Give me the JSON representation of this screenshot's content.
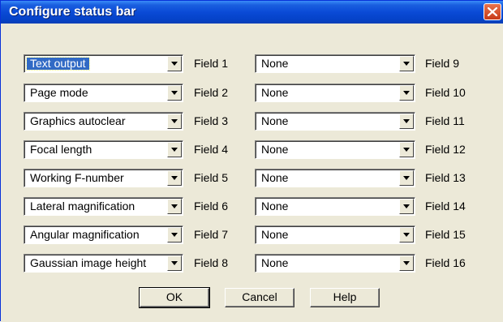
{
  "window": {
    "title": "Configure status bar"
  },
  "fields": [
    {
      "label": "Field 1",
      "value": "Text output",
      "selected": true
    },
    {
      "label": "Field 2",
      "value": "Page mode"
    },
    {
      "label": "Field 3",
      "value": "Graphics autoclear"
    },
    {
      "label": "Field 4",
      "value": "Focal length"
    },
    {
      "label": "Field 5",
      "value": "Working F-number"
    },
    {
      "label": "Field 6",
      "value": "Lateral magnification"
    },
    {
      "label": "Field 7",
      "value": "Angular magnification"
    },
    {
      "label": "Field 8",
      "value": "Gaussian image height"
    },
    {
      "label": "Field 9",
      "value": "None"
    },
    {
      "label": "Field 10",
      "value": "None"
    },
    {
      "label": "Field 11",
      "value": "None"
    },
    {
      "label": "Field 12",
      "value": "None"
    },
    {
      "label": "Field 13",
      "value": "None"
    },
    {
      "label": "Field 14",
      "value": "None"
    },
    {
      "label": "Field 15",
      "value": "None"
    },
    {
      "label": "Field 16",
      "value": "None"
    }
  ],
  "buttons": {
    "ok": "OK",
    "cancel": "Cancel",
    "help": "Help"
  },
  "colors": {
    "titlebar": "#0a4ad6",
    "selection": "#316ac5",
    "close": "#d9532c",
    "face": "#ece9d8"
  }
}
